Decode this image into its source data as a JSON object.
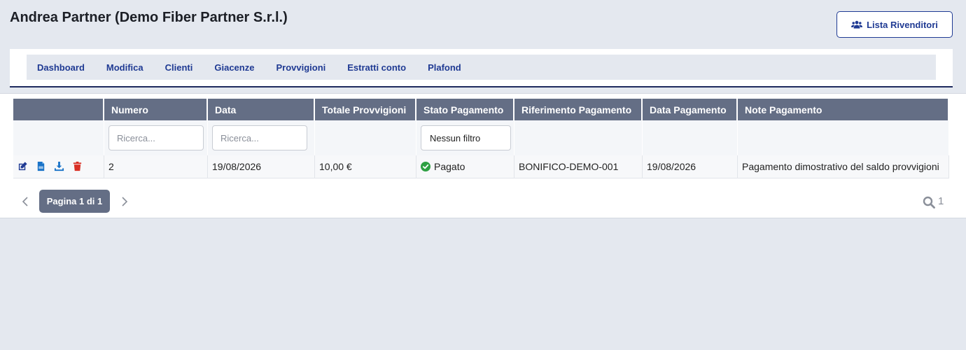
{
  "header": {
    "title": "Andrea Partner (Demo Fiber Partner S.r.l.)",
    "button_label": "Lista Rivenditori"
  },
  "nav": {
    "items": [
      "Dashboard",
      "Modifica",
      "Clienti",
      "Giacenze",
      "Provvigioni",
      "Estratti conto",
      "Plafond"
    ]
  },
  "table": {
    "columns": [
      "",
      "Numero",
      "Data",
      "Totale Provvigioni",
      "Stato Pagamento",
      "Riferimento Pagamento",
      "Data Pagamento",
      "Note Pagamento"
    ],
    "filters": {
      "numero_placeholder": "Ricerca...",
      "data_placeholder": "Ricerca...",
      "stato_value": "Nessun filtro"
    },
    "rows": [
      {
        "numero": "2",
        "data": "19/08/2026",
        "totale": "10,00 €",
        "stato": "Pagato",
        "riferimento": "BONIFICO-DEMO-001",
        "data_pagamento": "19/08/2026",
        "note": "Pagamento dimostrativo del saldo provvigioni"
      }
    ]
  },
  "pager": {
    "label": "Pagina 1 di 1",
    "count": "1"
  },
  "colors": {
    "accent": "#1f3a93",
    "header_bg": "#646e85",
    "status_ok": "#2ea043",
    "delete": "#d93025",
    "icon_blue": "#1a73c8"
  },
  "icons": {
    "header_button": "users-icon",
    "actions": [
      "edit-icon",
      "pdf-icon",
      "download-icon",
      "trash-icon"
    ],
    "status": "check-circle-icon",
    "pager": [
      "chevron-left-icon",
      "chevron-right-icon",
      "search-icon"
    ]
  }
}
